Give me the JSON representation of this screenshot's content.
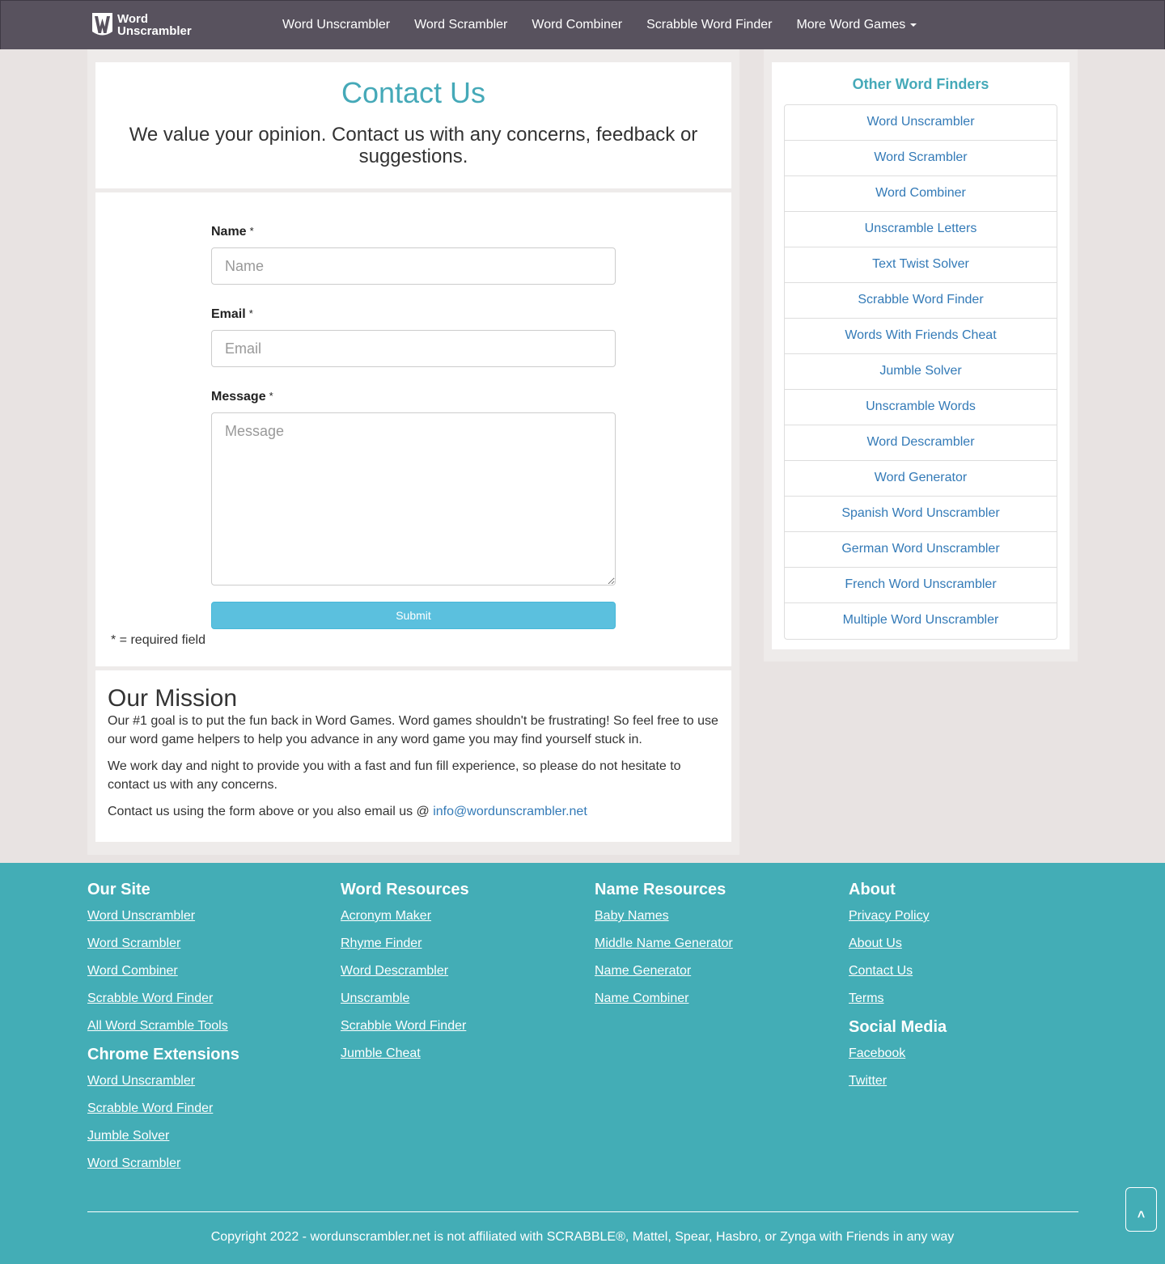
{
  "brand": {
    "line1": "Word",
    "line2": "Unscrambler",
    "logo_icon": "w-logo-icon"
  },
  "nav": {
    "items": [
      {
        "label": "Word Unscrambler"
      },
      {
        "label": "Word Scrambler"
      },
      {
        "label": "Word Combiner"
      },
      {
        "label": "Scrabble Word Finder"
      },
      {
        "label": "More Word Games"
      }
    ]
  },
  "header": {
    "title": "Contact Us",
    "subtitle": "We value your opinion. Contact us with any concerns, feedback or suggestions."
  },
  "form": {
    "name_label": "Name",
    "name_placeholder": "Name",
    "email_label": "Email",
    "email_placeholder": "Email",
    "message_label": "Message",
    "message_placeholder": "Message",
    "required_mark": "*",
    "submit_label": "Submit",
    "required_note": "* = required field"
  },
  "mission": {
    "title": "Our Mission",
    "p1": "Our #1 goal is to put the fun back in Word Games. Word games shouldn't be frustrating! So feel free to use our word game helpers to help you advance in any word game you may find yourself stuck in.",
    "p2": "We work day and night to provide you with a fast and fun fill experience, so please do not hesitate to contact us with any concerns.",
    "p3_prefix": "Contact us using the form above or you also email us @ ",
    "email": "info@wordunscrambler.net"
  },
  "sidebar": {
    "title": "Other Word Finders",
    "items": [
      "Word Unscrambler",
      "Word Scrambler",
      "Word Combiner",
      "Unscramble Letters",
      "Text Twist Solver",
      "Scrabble Word Finder",
      "Words With Friends Cheat",
      "Jumble Solver",
      "Unscramble Words",
      "Word Descrambler",
      "Word Generator",
      "Spanish Word Unscrambler",
      "German Word Unscrambler",
      "French Word Unscrambler",
      "Multiple Word Unscrambler"
    ]
  },
  "footer": {
    "our_site": {
      "title": "Our Site",
      "links": [
        "Word Unscrambler",
        "Word Scrambler",
        "Word Combiner",
        "Scrabble Word Finder",
        "All Word Scramble Tools"
      ]
    },
    "chrome": {
      "title": "Chrome Extensions",
      "links": [
        "Word Unscrambler",
        "Scrabble Word Finder",
        "Jumble Solver",
        "Word Scrambler"
      ]
    },
    "word_resources": {
      "title": "Word Resources",
      "links": [
        "Acronym Maker",
        "Rhyme Finder",
        "Word Descrambler",
        "Unscramble",
        "Scrabble Word Finder",
        "Jumble Cheat"
      ]
    },
    "name_resources": {
      "title": "Name Resources",
      "links": [
        "Baby Names",
        "Middle Name Generator",
        "Name Generator",
        "Name Combiner"
      ]
    },
    "about": {
      "title": "About",
      "links": [
        "Privacy Policy",
        "About Us",
        "Contact Us",
        "Terms"
      ]
    },
    "social": {
      "title": "Social Media",
      "links": [
        "Facebook",
        "Twitter"
      ]
    },
    "copyright": "Copyright 2022 - wordunscrambler.net is not affiliated with SCRABBLE®, Mattel, Spear, Hasbro, or Zynga with Friends in any way",
    "top_button": "˄"
  },
  "colors": {
    "nav_bg": "#58525e",
    "accent": "#45a9b8",
    "footer_bg": "#43adb6",
    "link": "#337ab7",
    "submit": "#5bc0de"
  }
}
